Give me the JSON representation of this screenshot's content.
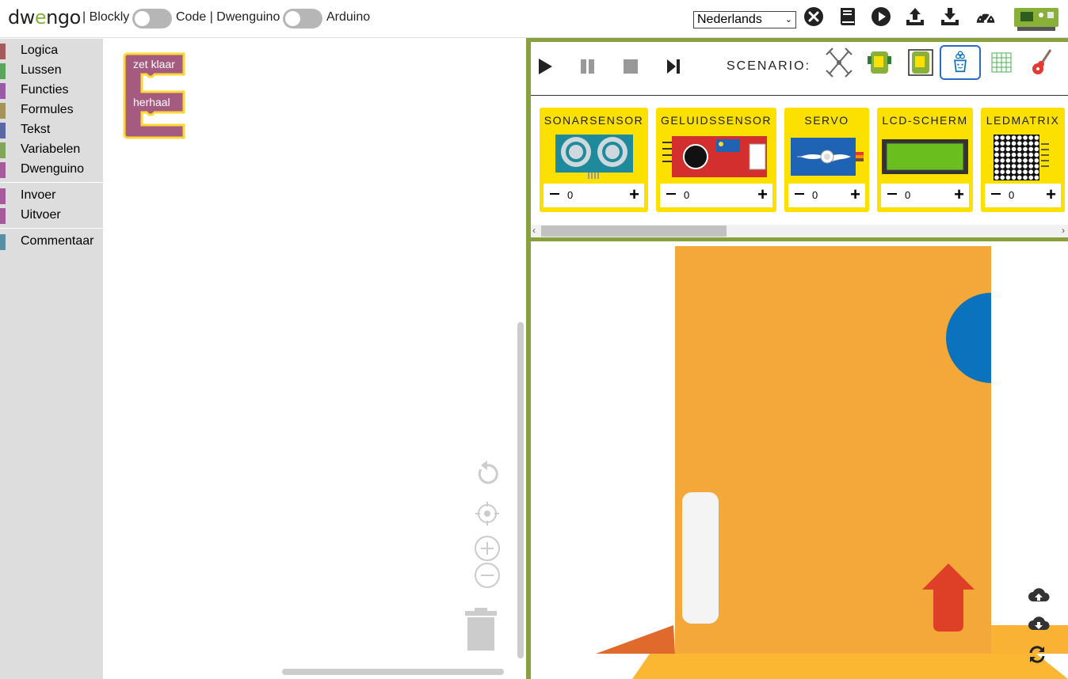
{
  "header": {
    "logo_text": "dw",
    "logo_e": "e",
    "logo_rest": "ngo",
    "label_blockly": "| Blockly",
    "label_code": "Code | Dwenguino",
    "label_arduino": "Arduino",
    "language_selected": "Nederlands",
    "icons": [
      "close-circle-icon",
      "book-icon",
      "play-circle-icon",
      "upload-icon",
      "download-icon",
      "gauge-icon",
      "dwenguino-board-icon"
    ]
  },
  "sidebar": {
    "categories": [
      {
        "label": "Logica",
        "color": "#a55b5b"
      },
      {
        "label": "Lussen",
        "color": "#5ba55b"
      },
      {
        "label": "Functies",
        "color": "#995ba5"
      },
      {
        "label": "Formules",
        "color": "#a5935b"
      },
      {
        "label": "Tekst",
        "color": "#5b67a5"
      },
      {
        "label": "Variabelen",
        "color": "#80a55b"
      },
      {
        "label": "Dwenguino",
        "color": "#a55b99"
      },
      {
        "label": "Invoer",
        "color": "#a55b99"
      },
      {
        "label": "Uitvoer",
        "color": "#a55b99"
      },
      {
        "label": "Commentaar",
        "color": "#5b8fa5"
      }
    ]
  },
  "workspace": {
    "block": {
      "setup_label": "zet klaar",
      "loop_label": "herhaal",
      "color": "#a55b80",
      "outline": "#fdd835"
    },
    "controls": [
      "reset-icon",
      "center-icon",
      "zoom-in-icon",
      "zoom-out-icon",
      "trash-icon"
    ]
  },
  "simulator": {
    "controls": [
      "play-icon",
      "pause-icon",
      "stop-icon",
      "step-icon"
    ],
    "scenario_label": "SCENARIO:",
    "scenarios": [
      "spyder-scenario-icon",
      "robot-car-scenario-icon",
      "robot-car-wall-scenario-icon",
      "socialrobot-scenario-icon",
      "led-matrix-scenario-icon",
      "guitar-scenario-icon"
    ],
    "active_scenario_index": 3,
    "components": [
      {
        "title": "SONARSENSOR",
        "count": "0"
      },
      {
        "title": "GELUIDSSENSOR",
        "count": "0"
      },
      {
        "title": "SERVO",
        "count": "0"
      },
      {
        "title": "LCD-SCHERM",
        "count": "0"
      },
      {
        "title": "LEDMATRIX",
        "count": "0"
      }
    ],
    "scene_icons": [
      "cloud-upload-icon",
      "cloud-download-icon",
      "refresh-icon"
    ],
    "colors": {
      "accent": "#89a03e",
      "scene_orange": "#f4a83a",
      "scene_blue": "#0b72bd",
      "scene_red": "#e04225",
      "card_yellow": "#fce000"
    }
  }
}
